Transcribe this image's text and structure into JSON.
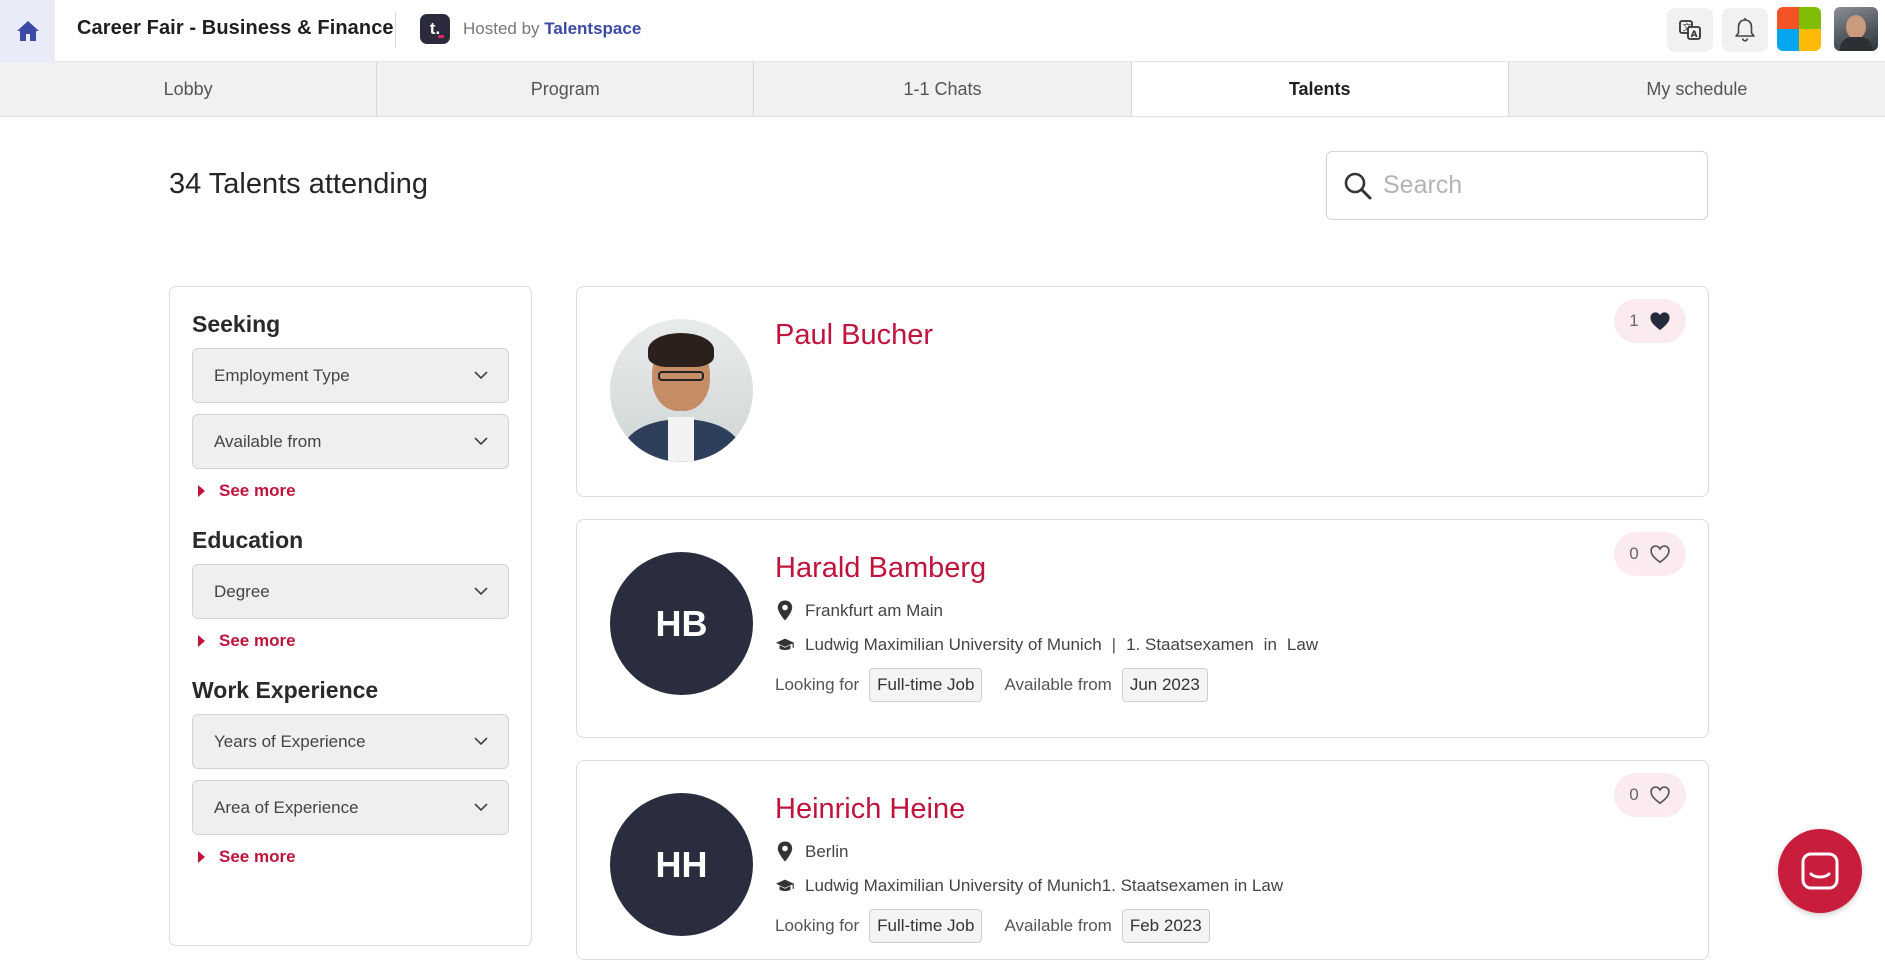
{
  "header": {
    "title": "Career Fair - Business & Finance",
    "hosted_by_prefix": "Hosted by",
    "host_name": "Talentspace",
    "host_logo_letter": "t."
  },
  "tabs": [
    {
      "label": "Lobby",
      "active": false
    },
    {
      "label": "Program",
      "active": false
    },
    {
      "label": "1-1 Chats",
      "active": false
    },
    {
      "label": "Talents",
      "active": true
    },
    {
      "label": "My schedule",
      "active": false
    }
  ],
  "main": {
    "heading": "34 Talents attending",
    "search_placeholder": "Search"
  },
  "filters": {
    "groups": [
      {
        "title": "Seeking",
        "selects": [
          "Employment Type",
          "Available from"
        ],
        "see_more": "See more"
      },
      {
        "title": "Education",
        "selects": [
          "Degree"
        ],
        "see_more": "See more"
      },
      {
        "title": "Work Experience",
        "selects": [
          "Years of Experience",
          "Area of Experience"
        ],
        "see_more": "See more"
      }
    ]
  },
  "talents": [
    {
      "name": "Paul Bucher",
      "likes": "1",
      "liked": true,
      "has_photo": true
    },
    {
      "name": "Harald Bamberg",
      "initials": "HB",
      "likes": "0",
      "liked": false,
      "location": "Frankfurt am Main",
      "university": "Ludwig Maximilian University of Munich",
      "separator": "|",
      "degree": "1. Staatsexamen",
      "in_word": "in",
      "field": "Law",
      "looking_for_label": "Looking for",
      "looking_for": "Full-time Job",
      "available_label": "Available from",
      "available": "Jun 2023"
    },
    {
      "name": "Heinrich Heine",
      "initials": "HH",
      "likes": "0",
      "liked": false,
      "location": "Berlin",
      "education_line": "Ludwig Maximilian University of Munich1. Staatsexamen in Law",
      "looking_for_label": "Looking for",
      "looking_for": "Full-time Job",
      "available_label": "Available from",
      "available": "Feb 2023"
    }
  ],
  "icons": {
    "home": "home-icon",
    "translate": "translate-icon",
    "notifications": "bell-icon",
    "search": "search-icon",
    "heart": "heart-icon",
    "location": "map-pin-icon",
    "education": "graduation-cap-icon",
    "chat": "chat-icon"
  },
  "colors": {
    "accent": "#c0143c",
    "home_bg": "#e8eaf7",
    "home_icon": "#3a4aa6",
    "avatar_bg": "#2a2d3e"
  }
}
